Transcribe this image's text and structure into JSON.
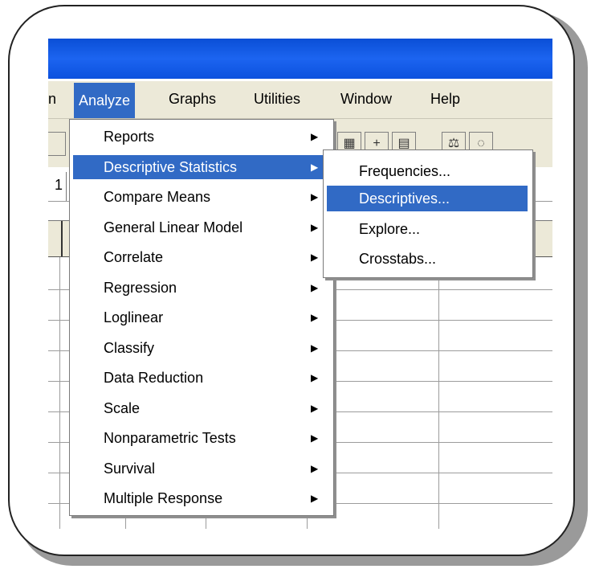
{
  "menubar": {
    "partial_left": "n",
    "items": [
      "Analyze",
      "Graphs",
      "Utilities",
      "Window",
      "Help"
    ]
  },
  "toolbar": {
    "cell_ref_partial": "1"
  },
  "analyze_menu": {
    "items": [
      {
        "label": "Reports",
        "has_submenu": true
      },
      {
        "label": "Descriptive Statistics",
        "has_submenu": true,
        "highlighted": true
      },
      {
        "label": "Compare Means",
        "has_submenu": true
      },
      {
        "label": "General Linear Model",
        "has_submenu": true
      },
      {
        "label": "Correlate",
        "has_submenu": true
      },
      {
        "label": "Regression",
        "has_submenu": true
      },
      {
        "label": "Loglinear",
        "has_submenu": true
      },
      {
        "label": "Classify",
        "has_submenu": true
      },
      {
        "label": "Data Reduction",
        "has_submenu": true
      },
      {
        "label": "Scale",
        "has_submenu": true
      },
      {
        "label": "Nonparametric Tests",
        "has_submenu": true
      },
      {
        "label": "Survival",
        "has_submenu": true
      },
      {
        "label": "Multiple Response",
        "has_submenu": true
      }
    ]
  },
  "descriptive_submenu": {
    "items": [
      {
        "label": "Frequencies..."
      },
      {
        "label": "Descriptives...",
        "highlighted": true
      },
      {
        "label": "Explore..."
      },
      {
        "label": "Crosstabs..."
      }
    ]
  },
  "icons": {
    "submenu_arrow": "triangle-right-icon"
  },
  "colors": {
    "title_bar": "#1c64f0",
    "highlight": "#316ac5",
    "menu_bg": "#ece9d8"
  }
}
